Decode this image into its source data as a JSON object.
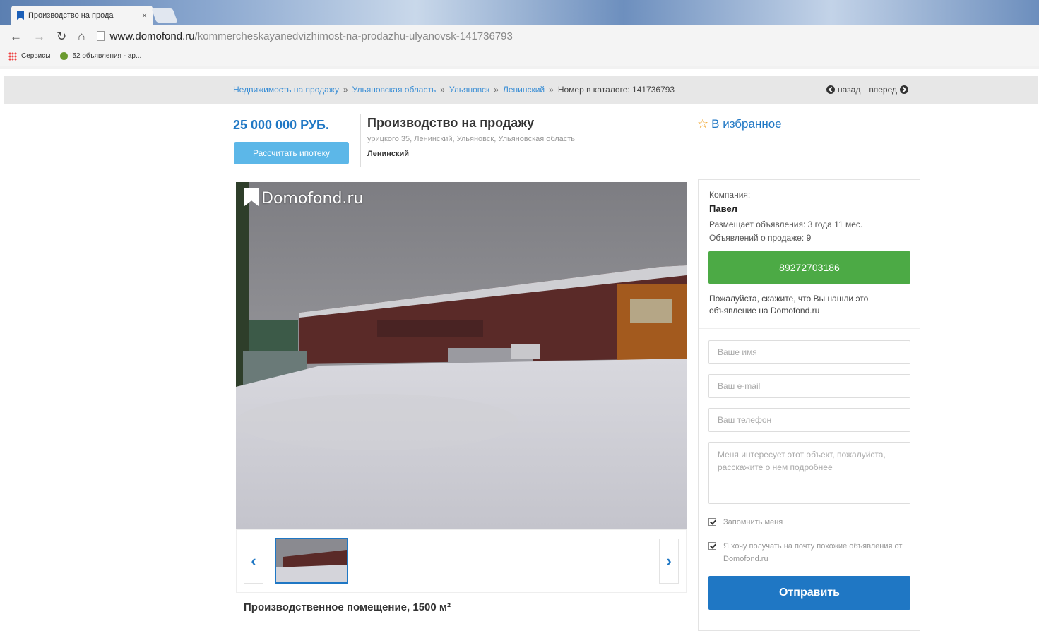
{
  "browser": {
    "tab_title": "Производство на прода",
    "tab_close": "×",
    "url_host": "www.domofond.ru",
    "url_path": "/kommercheskayanedvizhimost-na-prodazhu-ulyanovsk-141736793",
    "bookmarks": [
      "Сервисы",
      "52 объявления - ар..."
    ]
  },
  "breadcrumb": {
    "items": [
      "Недвижимость на продажу",
      "Ульяновская область",
      "Ульяновск",
      "Ленинский"
    ],
    "catalog": "Номер в каталоге: 141736793",
    "separator": "»",
    "back": "назад",
    "forward": "вперед"
  },
  "listing": {
    "price": "25 000 000 РУБ.",
    "mortgage_button": "Рассчитать ипотеку",
    "title": "Производство на продажу",
    "address": "урицкого 35, Ленинский, Ульяновск, Ульяновская область",
    "district": "Ленинский",
    "favorite": "В избранное",
    "watermark": "Domofond.ru",
    "subtitle": "Производственное помещение, 1500 м²"
  },
  "contact": {
    "company_label": "Компания:",
    "name": "Павел",
    "posting_since": "Размещает объявления: 3 года 11 мес.",
    "ads_count": "Объявлений о продаже: 9",
    "phone": "89272703186",
    "note": "Пожалуйста, скажите, что Вы нашли это объявление на Domofond.ru"
  },
  "form": {
    "name_placeholder": "Ваше имя",
    "email_placeholder": "Ваш e-mail",
    "phone_placeholder": "Ваш телефон",
    "message": "Меня интересует этот объект, пожалуйста, расскажите о нем подробнее",
    "remember_me": "Запомнить меня",
    "subscribe": "Я хочу получать на почту похожие объявления от Domofond.ru",
    "submit": "Отправить"
  },
  "colors": {
    "accent": "#1f77c4",
    "phone_button": "#4caa45",
    "mortgage_button": "#5cb7e8"
  }
}
